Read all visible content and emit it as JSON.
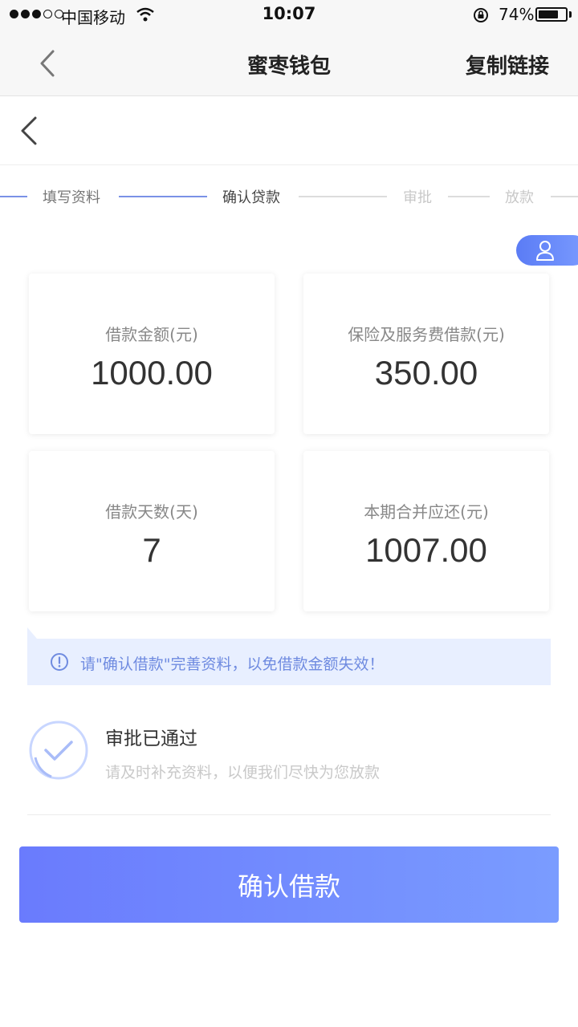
{
  "status_bar": {
    "carrier": "中国移动",
    "time": "10:07",
    "battery_text": "74%",
    "battery_level": 0.74
  },
  "nav": {
    "title": "蜜枣钱包",
    "action": "复制链接"
  },
  "steps": [
    {
      "label": "填写资料",
      "state": "done"
    },
    {
      "label": "确认贷款",
      "state": "current"
    },
    {
      "label": "审批",
      "state": "pending"
    },
    {
      "label": "放款",
      "state": "pending"
    }
  ],
  "cards": [
    {
      "label": "借款金额(元)",
      "value": "1000.00"
    },
    {
      "label": "保险及服务费借款(元)",
      "value": "350.00"
    },
    {
      "label": "借款天数(天)",
      "value": "7"
    },
    {
      "label": "本期合并应还(元)",
      "value": "1007.00"
    }
  ],
  "notice": {
    "text": "请\"确认借款\"完善资料，以免借款金额失效！"
  },
  "approval": {
    "title": "审批已通过",
    "subtitle": "请及时补充资料，以便我们尽快为您放款"
  },
  "confirm_button": {
    "label": "确认借款"
  },
  "colors": {
    "accent": "#6a7bfd",
    "notice_bg": "#e8efff",
    "notice_text": "#6f8be0"
  }
}
